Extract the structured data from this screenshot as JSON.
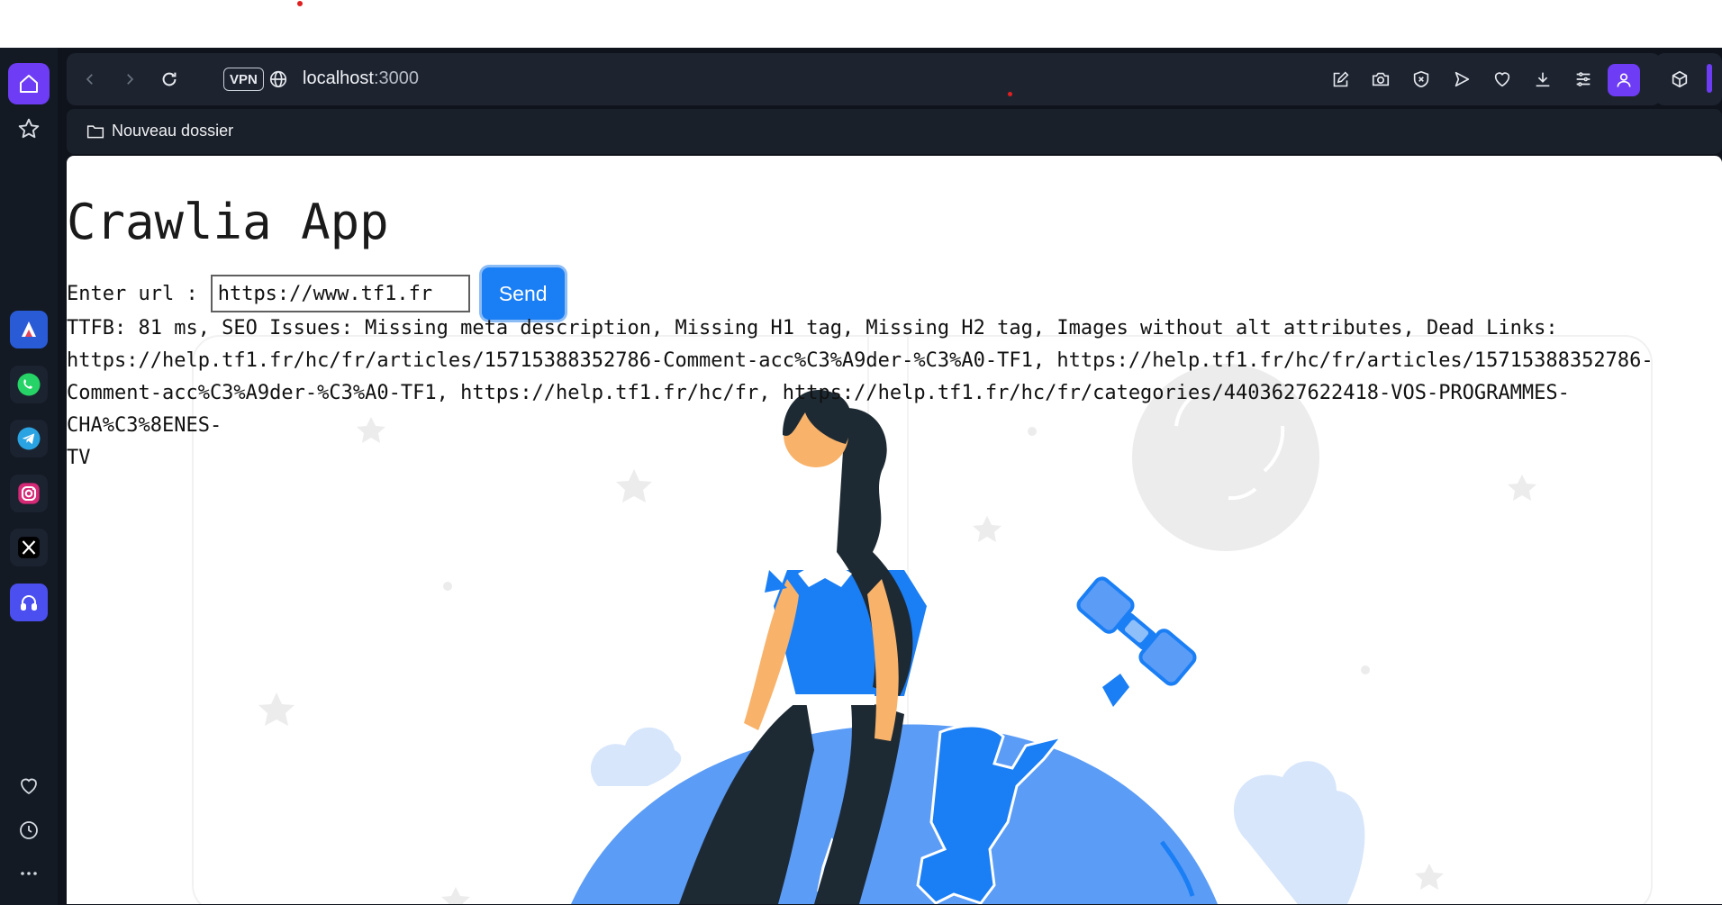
{
  "browser": {
    "vpn_label": "VPN",
    "url_host": "localhost",
    "url_port": ":3000",
    "bookmark_folder": "Nouveau dossier",
    "accent": "#6d3cf4"
  },
  "sidebar": {
    "apps": [
      {
        "name": "aria-app-icon",
        "color": "#2a5bd7"
      },
      {
        "name": "whatsapp-icon",
        "color": "#25d366"
      },
      {
        "name": "telegram-icon",
        "color": "#2aa3e2"
      },
      {
        "name": "instagram-icon",
        "color": "#d62976"
      },
      {
        "name": "x-icon",
        "color": "#000000"
      },
      {
        "name": "music-app-icon",
        "color": "#4b4ff0"
      }
    ]
  },
  "page": {
    "title": "Crawlia App",
    "url_label": "Enter url :",
    "url_value": "https://www.tf1.fr",
    "send_label": "Send",
    "results_text": "TTFB: 81 ms, SEO Issues: Missing meta description, Missing H1 tag, Missing H2 tag, Images without alt attributes, Dead Links:\nhttps://help.tf1.fr/hc/fr/articles/15715388352786-Comment-acc%C3%A9der-%C3%A0-TF1, https://help.tf1.fr/hc/fr/articles/15715388352786-\nComment-acc%C3%A9der-%C3%A0-TF1, https://help.tf1.fr/hc/fr, https://help.tf1.fr/hc/fr/categories/4403627622418-VOS-PROGRAMMES-CHA%C3%8ENES-\nTV",
    "button_color": "#1a7ef5"
  }
}
